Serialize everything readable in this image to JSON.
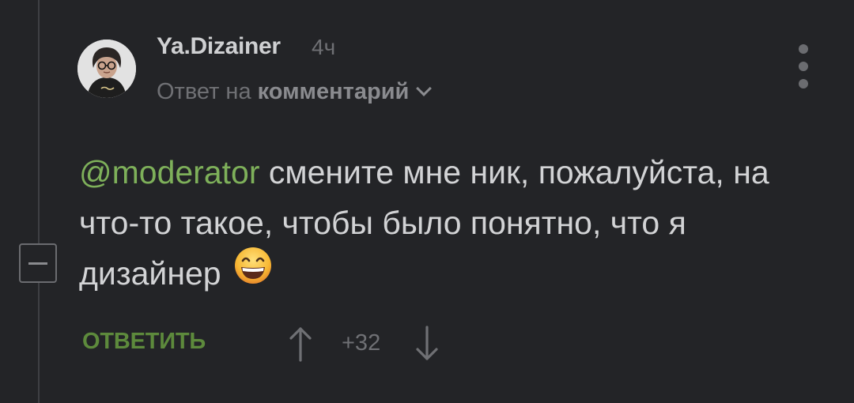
{
  "comment": {
    "author": "Ya.Dizainer",
    "time": "4ч",
    "reply_prefix": "Ответ на",
    "reply_target": "комментарий",
    "mention": "@moderator",
    "text": " смените мне ник, пожалуйста, на что-то такое, чтобы было понятно, что я дизайнер",
    "emoji": "grinning-smiling-eyes-emoji"
  },
  "actions": {
    "reply_label": "ОТВЕТИТЬ",
    "score": "+32"
  },
  "colors": {
    "background": "#232427",
    "mention": "#7eb05a",
    "reply_button": "#5d8a3c",
    "muted_text": "#6f7074",
    "body_text": "#d2d3d5"
  }
}
